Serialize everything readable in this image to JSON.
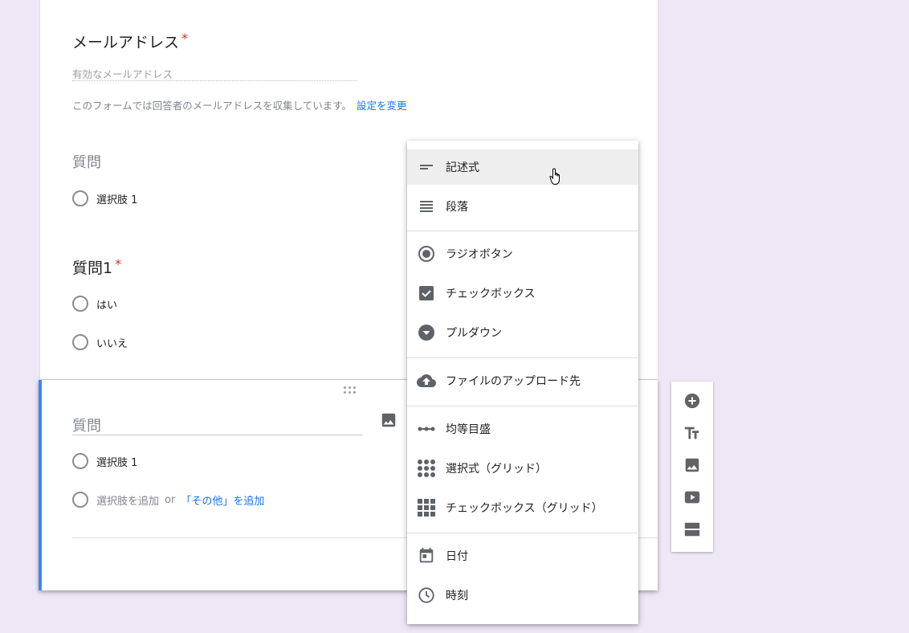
{
  "section1": {
    "email_title": "メールアドレス",
    "required_mark": "*",
    "email_placeholder": "有効なメールアドレス",
    "note": "このフォームでは回答者のメールアドレスを収集しています。",
    "note_link": "設定を変更"
  },
  "question_a": {
    "title": "質問",
    "options": [
      "選択肢 1"
    ]
  },
  "question_b": {
    "title": "質問1",
    "required_mark": "*",
    "options": [
      "はい",
      "いいえ"
    ]
  },
  "active_question": {
    "title_placeholder": "質問",
    "option1": "選択肢 1",
    "add_option": "選択肢を追加",
    "or_text": "or",
    "add_other": "「その他」を追加"
  },
  "type_menu": {
    "items": [
      {
        "label": "記述式",
        "icon": "short-answer-icon",
        "highlighted": true
      },
      {
        "label": "段落",
        "icon": "paragraph-icon"
      },
      {
        "label": "ラジオボタン",
        "icon": "radio-icon"
      },
      {
        "label": "チェックボックス",
        "icon": "checkbox-icon"
      },
      {
        "label": "プルダウン",
        "icon": "dropdown-icon"
      },
      {
        "label": "ファイルのアップロード先",
        "icon": "cloud-upload-icon"
      },
      {
        "label": "均等目盛",
        "icon": "linear-scale-icon"
      },
      {
        "label": "選択式（グリッド）",
        "icon": "grid-radio-icon"
      },
      {
        "label": "チェックボックス（グリッド）",
        "icon": "grid-checkbox-icon"
      },
      {
        "label": "日付",
        "icon": "calendar-icon"
      },
      {
        "label": "時刻",
        "icon": "clock-icon"
      }
    ]
  },
  "side_toolbar": {
    "items": [
      "add-question-icon",
      "add-title-icon",
      "add-image-icon",
      "add-video-icon",
      "add-section-icon"
    ]
  },
  "colors": {
    "background": "#ede7f6",
    "accent": "#4285f4",
    "link": "#1a73e8",
    "required": "#d93025"
  }
}
